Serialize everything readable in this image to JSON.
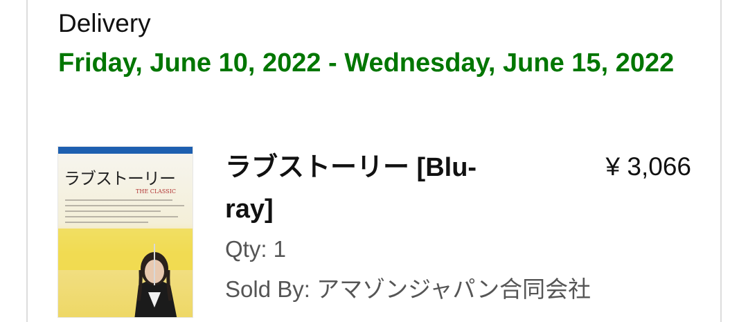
{
  "delivery": {
    "label": "Delivery",
    "date_range": "Friday, June 10, 2022 - Wednesday, June 15, 2022"
  },
  "item": {
    "title": "ラブストーリー [Blu-ray]",
    "price": "¥ 3,066",
    "qty": "Qty: 1",
    "sold_by": "Sold By: アマゾンジャパン合同会社",
    "thumbnail": {
      "cover_title": "ラブストーリー",
      "cover_subtitle": "THE CLASSIC"
    }
  },
  "colors": {
    "delivery_date": "#007600",
    "text_primary": "#111111",
    "text_secondary": "#555555",
    "card_border": "#dcdcdc"
  }
}
